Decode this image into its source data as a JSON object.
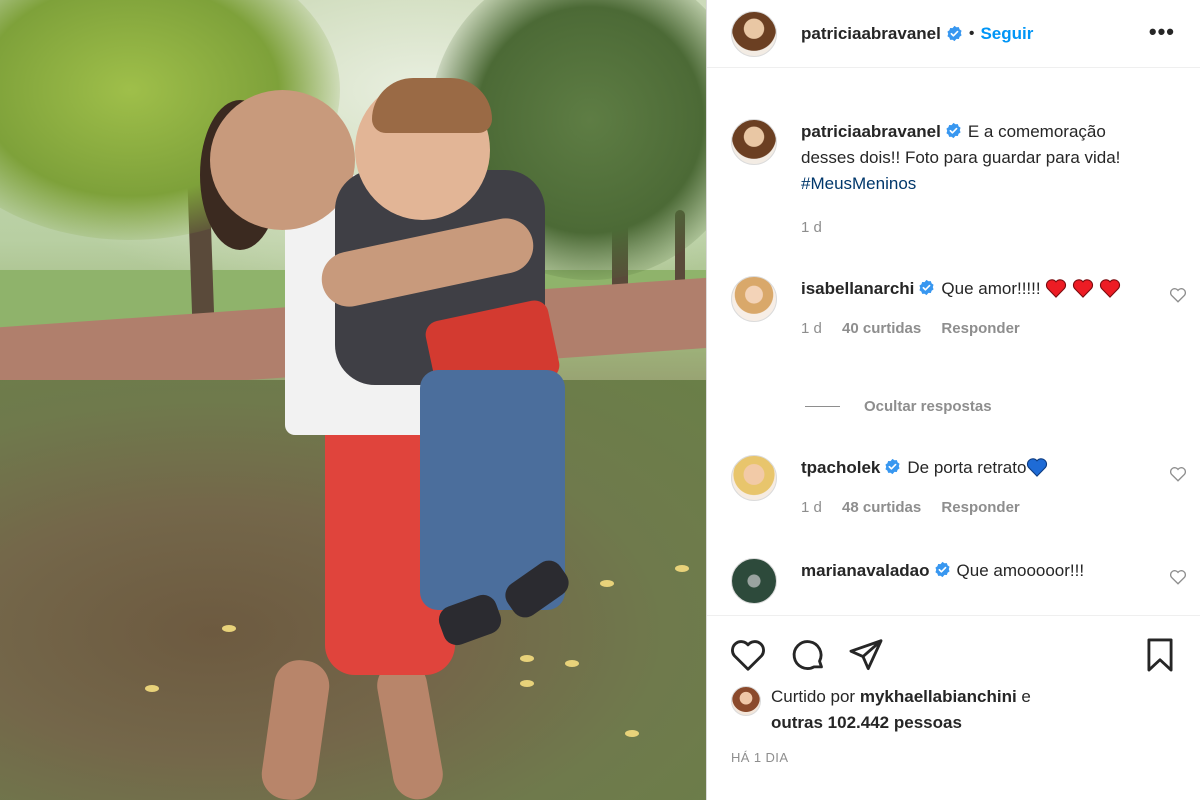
{
  "post": {
    "author": "patriciaabravanel",
    "follow_label": "Seguir",
    "more_label": "•••",
    "separator": "•"
  },
  "caption": {
    "username": "patriciaabravanel",
    "text": "E a comemoração desses dois!! Foto para guardar para vida!",
    "hashtag": "#MeusMeninos",
    "time": "1 d"
  },
  "comments": [
    {
      "username": "isabellanarchi",
      "text": "Que amor!!!!!",
      "emoji": "red-heart",
      "emoji_count": 3,
      "time": "1 d",
      "likes": "40 curtidas",
      "reply_label": "Responder"
    },
    {
      "username": "tpacholek",
      "text": "De porta retrato",
      "emoji": "blue-heart",
      "emoji_count": 1,
      "time": "1 d",
      "likes": "48 curtidas",
      "reply_label": "Responder"
    },
    {
      "username": "marianavaladao",
      "text": "Que amooooor!!!"
    }
  ],
  "hide_replies_label": "Ocultar respostas",
  "likes": {
    "prefix": "Curtido por",
    "user": "mykhaellabianchini",
    "conj": "e",
    "others": "outras 102.442 pessoas"
  },
  "time_ago": "HÁ 1 DIA",
  "colors": {
    "link_blue": "#0095f6",
    "hashtag": "#00376b",
    "muted": "#8e8e8e",
    "heart_red": "#ed1c24",
    "heart_blue": "#1e6bd6"
  },
  "icons": [
    "verified-badge-icon",
    "like-heart-icon",
    "comment-icon",
    "share-icon",
    "bookmark-icon",
    "more-icon"
  ]
}
